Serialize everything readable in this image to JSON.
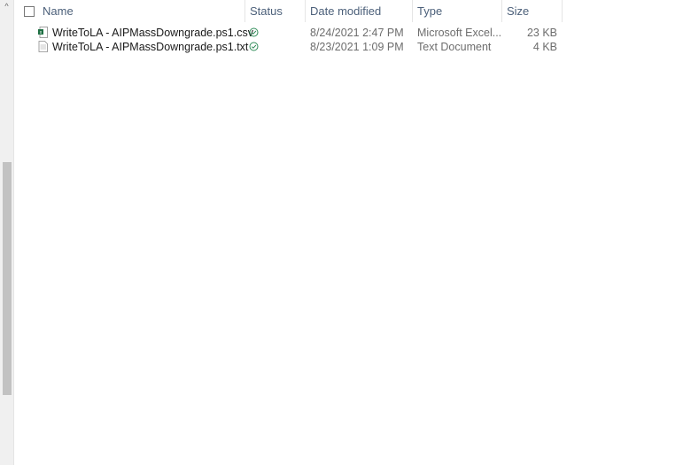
{
  "columns": {
    "name": "Name",
    "status": "Status",
    "date_modified": "Date modified",
    "type": "Type",
    "size": "Size"
  },
  "files": [
    {
      "name": "WriteToLA - AIPMassDowngrade.ps1.csv",
      "icon": "excel-csv-file-icon",
      "status_icon": "available-check-icon",
      "date_modified": "8/24/2021 2:47 PM",
      "type": "Microsoft Excel...",
      "size": "23 KB"
    },
    {
      "name": "WriteToLA - AIPMassDowngrade.ps1.txt",
      "icon": "text-file-icon",
      "status_icon": "available-check-icon",
      "date_modified": "8/23/2021 1:09 PM",
      "type": "Text Document",
      "size": "4 KB"
    }
  ],
  "colors": {
    "status_check": "#2e8b57",
    "excel_green": "#1d6f42",
    "header_text": "#4c607a"
  }
}
